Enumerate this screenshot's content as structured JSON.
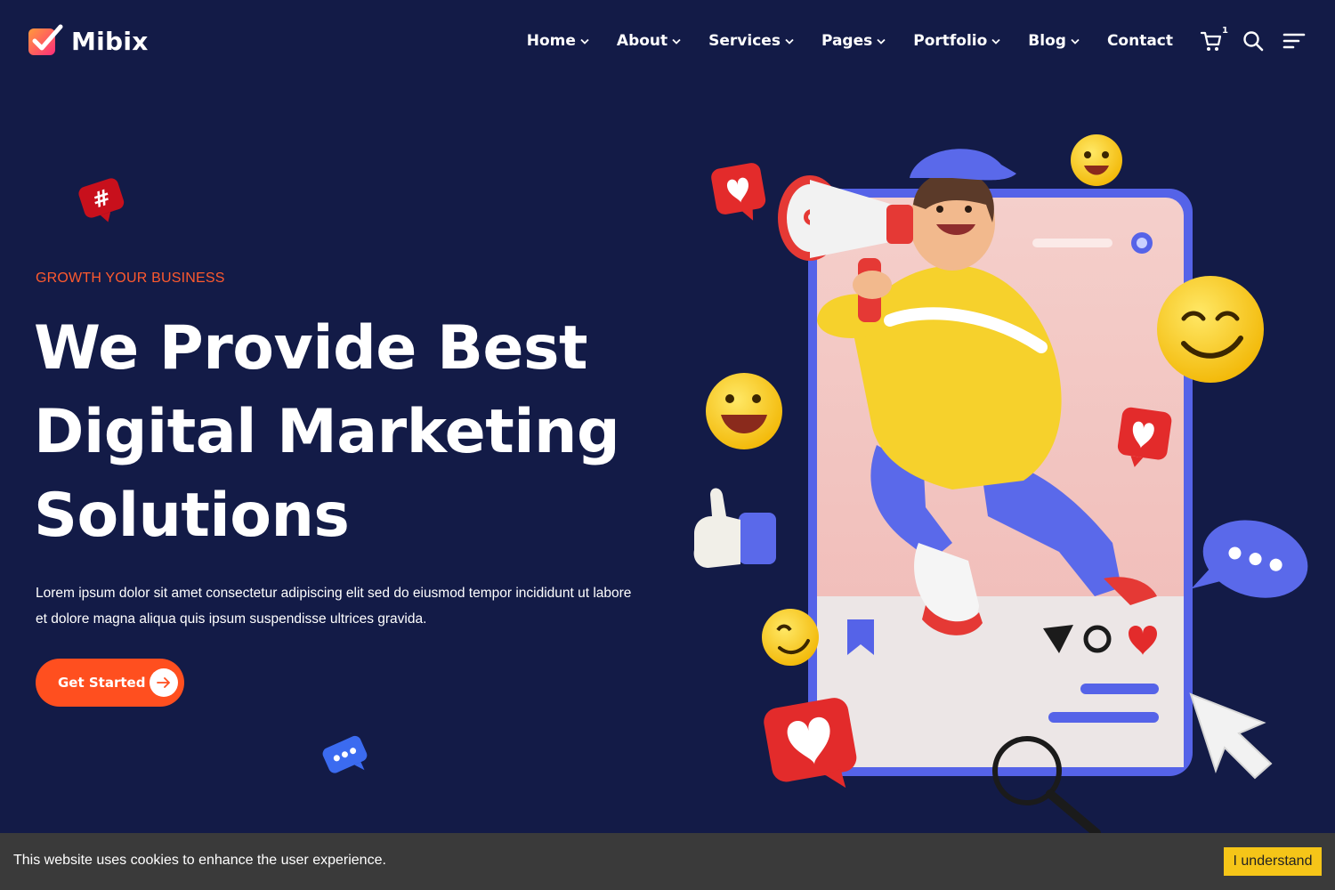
{
  "brand": {
    "name": "Mibix"
  },
  "nav": {
    "items": [
      {
        "label": "Home",
        "has_dropdown": true
      },
      {
        "label": "About",
        "has_dropdown": true
      },
      {
        "label": "Services",
        "has_dropdown": true
      },
      {
        "label": "Pages",
        "has_dropdown": true
      },
      {
        "label": "Portfolio",
        "has_dropdown": true
      },
      {
        "label": "Blog",
        "has_dropdown": true
      },
      {
        "label": "Contact",
        "has_dropdown": false
      }
    ],
    "cart_count": "1",
    "icons": [
      "cart-icon",
      "search-icon",
      "menu-icon"
    ]
  },
  "hero": {
    "tagline": "GROWTH YOUR BUSINESS",
    "headline": {
      "line1": "We Provide Best",
      "line2": "Digital Marketing",
      "line3": "Solutions"
    },
    "description": "Lorem ipsum dolor sit amet consectetur adipiscing elit sed do eiusmod tempor incididunt ut labore et dolore magna aliqua quis ipsum suspendisse ultrices gravida.",
    "cta_label": "Get Started"
  },
  "cookie": {
    "message": "This website uses cookies to enhance the user experience.",
    "button_label": "I understand"
  },
  "colors": {
    "background": "#131b47",
    "accent": "#ff4f1f",
    "tagline": "#ff5a2e",
    "cookie_bg": "#3a3a3a",
    "cookie_button": "#f5c518"
  }
}
